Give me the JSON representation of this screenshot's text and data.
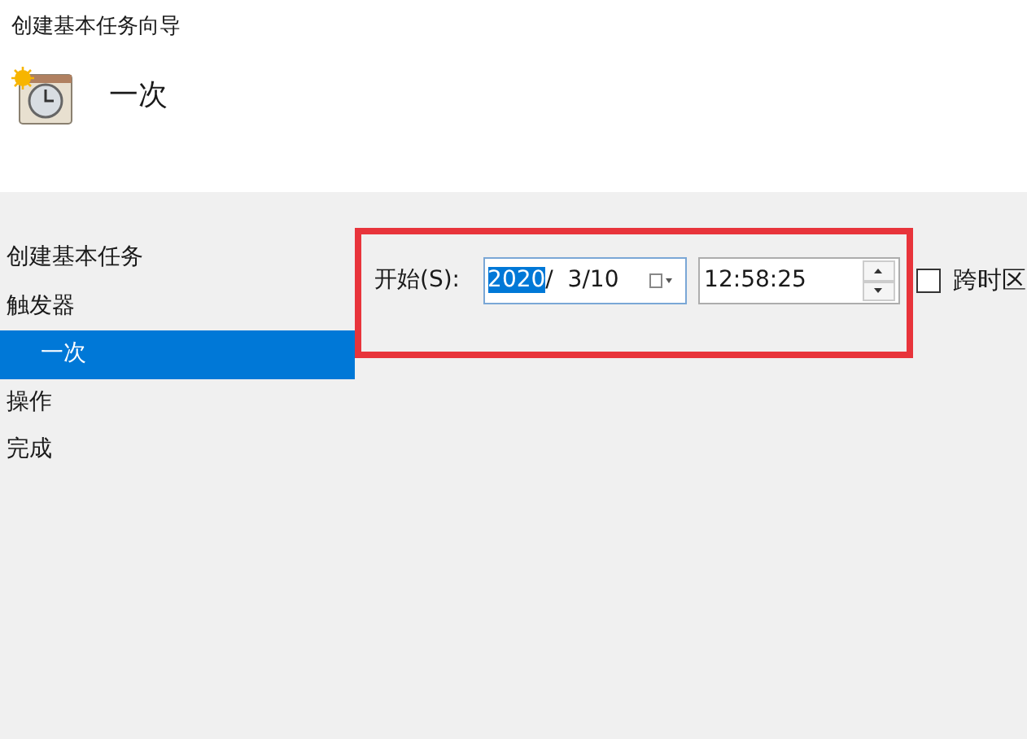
{
  "window": {
    "title": "创建基本任务向导"
  },
  "header": {
    "heading": "一次"
  },
  "steps": [
    {
      "label": "创建基本任务",
      "selected": false
    },
    {
      "label": "触发器",
      "selected": false,
      "children": [
        {
          "label": "一次",
          "selected": true
        }
      ]
    },
    {
      "label": "操作",
      "selected": false
    },
    {
      "label": "完成",
      "selected": false
    }
  ],
  "start": {
    "label": "开始(S):",
    "date_parts": [
      {
        "text": "2020",
        "selected": true
      },
      {
        "text": "/  3/10",
        "selected": false
      }
    ],
    "time": "12:58:25"
  },
  "timezone_checkbox": {
    "label": "跨时区",
    "checked": false
  },
  "annotation": {
    "kind": "highlight-frame"
  }
}
